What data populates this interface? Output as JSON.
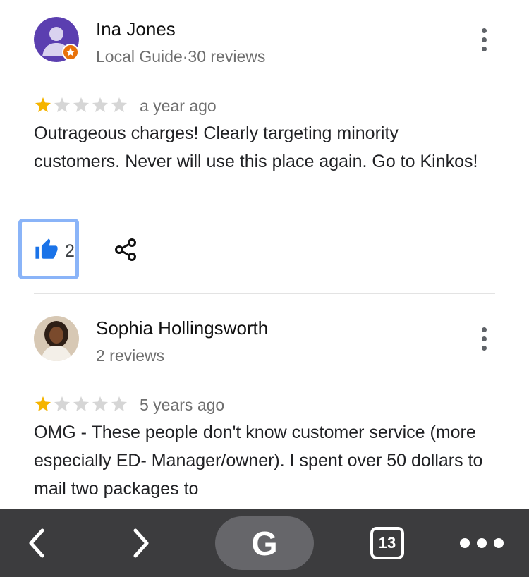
{
  "reviews": [
    {
      "author": "Ina Jones",
      "meta": "Local Guide·30 reviews",
      "rating": 1,
      "max_rating": 5,
      "date": "a year ago",
      "text": "Outrageous charges! Clearly targeting minority customers. Never will use this place again. Go to Kinkos!",
      "likes": "2"
    },
    {
      "author": "Sophia Hollingsworth",
      "meta": "2 reviews",
      "rating": 1,
      "max_rating": 5,
      "date": "5 years ago",
      "text": "OMG - These people don't know customer service (more especially ED- Manager/owner).  I spent over 50 dollars to mail two packages to"
    }
  ],
  "browser_bar": {
    "tab_count": "13",
    "search_letter": "G"
  },
  "colors": {
    "star_filled": "#f5b400",
    "star_empty": "#d6d6d6",
    "like_blue": "#1a73e8",
    "focus_ring": "#8ab4f8",
    "toolbar_bg": "#3c3c3e"
  }
}
